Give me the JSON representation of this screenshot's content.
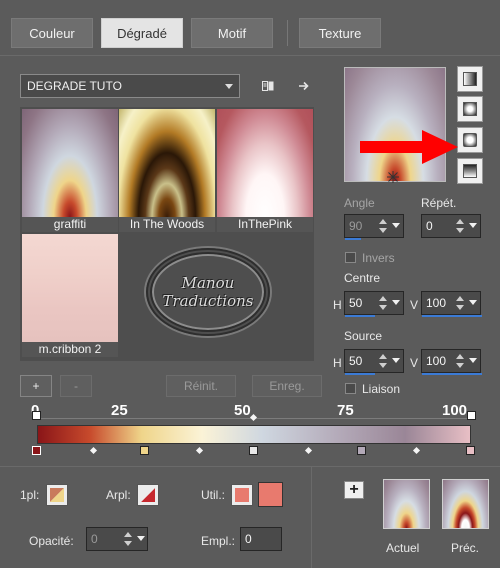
{
  "tabs": [
    {
      "label": "Couleur",
      "active": false
    },
    {
      "label": "Dégradé",
      "active": true
    },
    {
      "label": "Motif",
      "active": false
    },
    {
      "label": "Texture",
      "active": false
    }
  ],
  "library": {
    "selected": "DEGRADE TUTO",
    "items": [
      {
        "name": "graffiti"
      },
      {
        "name": "In The Woods"
      },
      {
        "name": "InThePink"
      },
      {
        "name": "m.cribbon 2"
      }
    ],
    "watermark_line1": "Manou",
    "watermark_line2": "Traductions",
    "add_label": "+",
    "remove_label": "-",
    "reset_label": "Réinit.",
    "save_label": "Enreg."
  },
  "settings": {
    "angle_label": "Angle",
    "angle_value": "90",
    "repeat_label": "Répét.",
    "repeat_value": "0",
    "invert_label": "Invers",
    "center_label": "Centre",
    "center_h_label": "H",
    "center_h_value": "50",
    "center_v_label": "V",
    "center_v_value": "100",
    "source_label": "Source",
    "source_h_label": "H",
    "source_h_value": "50",
    "source_v_label": "V",
    "source_v_value": "100",
    "link_label": "Liaison"
  },
  "scale": [
    "0",
    "25",
    "50",
    "75",
    "100"
  ],
  "editor": {
    "one_pl_label": "1pl:",
    "arpl_label": "Arpl:",
    "util_label": "Util.:",
    "opacity_label": "Opacité:",
    "opacity_value": "0",
    "empl_label": "Empl.:",
    "empl_value": "0"
  },
  "samples": {
    "add_label": "+",
    "current_label": "Actuel",
    "previous_label": "Préc."
  },
  "colors": {
    "accent": "#3b7bd6",
    "red_arrow": "#ff0000",
    "util_swatch": "#e87a6e"
  }
}
